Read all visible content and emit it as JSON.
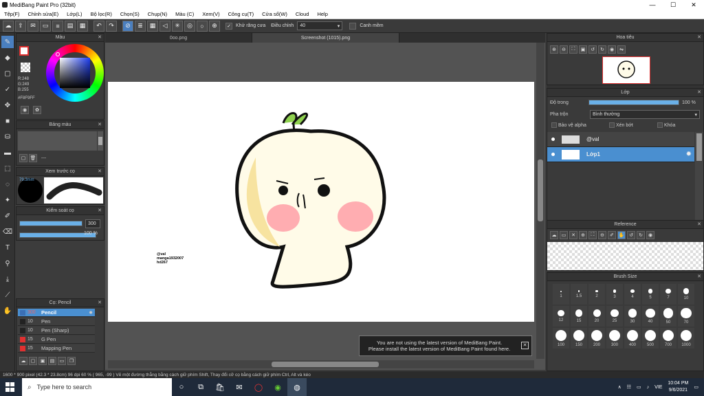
{
  "window": {
    "title": "MediBang Paint Pro (32bit)",
    "min": "—",
    "max": "☐",
    "close": "✕"
  },
  "menu": [
    "Tệp(F)",
    "Chỉnh sửa(E)",
    "Lớp(L)",
    "Bộ lọc(R)",
    "Chọn(S)",
    "Chụp(N)",
    "Màu (C)",
    "Xem(V)",
    "Công cụ(T)",
    "Cửa sổ(W)",
    "Cloud",
    "Help"
  ],
  "toolbar": {
    "antialias": "Khử răng cưa",
    "adjust": "Điều chỉnh",
    "adjust_value": "40",
    "smoothing": "Canh mềm"
  },
  "tabs": [
    "0oo.png",
    "Screenshot (1015).png"
  ],
  "color_panel": {
    "title": "Màu",
    "r": "R:248",
    "g": "G:249",
    "b": "B:255",
    "hex": "#F8F9FF"
  },
  "palette_panel": {
    "title": "Bảng màu",
    "dash": "---"
  },
  "preview_panel": {
    "title": "Xem trước cọ",
    "size": "79.3mm"
  },
  "brush_control": {
    "title": "Kiểm soát cọ",
    "size": "300",
    "opacity": "100 %"
  },
  "brush_list": {
    "title": "Cọ: Pencil",
    "items": [
      {
        "size": "300",
        "name": "Pencil",
        "color": "#3b6fb5"
      },
      {
        "size": "10",
        "name": "Pen",
        "color": "#222"
      },
      {
        "size": "10",
        "name": "Pen (Sharp)",
        "color": "#222"
      },
      {
        "size": "15",
        "name": "G Pen",
        "color": "#e03030"
      },
      {
        "size": "15",
        "name": "Mapping Pen",
        "color": "#e03030"
      }
    ]
  },
  "navigator": {
    "title": "Hoa tiêu"
  },
  "layer_panel": {
    "title": "Lớp",
    "opacity_label": "Độ trong",
    "opacity_value": "100 %",
    "blend_label": "Pha trộn",
    "blend_value": "Bình thường",
    "protect_alpha": "Bảo vệ alpha",
    "clip": "Xén bớt",
    "lock": "Khóa",
    "layers": [
      {
        "name": "@val"
      },
      {
        "name": "Lớp1"
      }
    ]
  },
  "reference_panel": {
    "title": "Reference"
  },
  "brush_size_panel": {
    "title": "Brush Size",
    "sizes": [
      "1",
      "1.5",
      "2",
      "3",
      "4",
      "5",
      "7",
      "10",
      "12",
      "15",
      "20",
      "25",
      "30",
      "40",
      "50",
      "70",
      "100",
      "150",
      "200",
      "300",
      "400",
      "500",
      "700",
      "1000"
    ]
  },
  "canvas_text": {
    "line1": "@val",
    "line2": "manga1932007",
    "line3": "hd267"
  },
  "notification": {
    "line1": "You are not using the latest version of MediBang Paint.",
    "line2": "Please install the latest version of MediBang Paint found here."
  },
  "statusbar": "1600 * 900 pixel  (42.3 * 23.8cm)  96 dpi  60 %  ( 965, -99 )  Vẽ một đường thẳng bằng cách giữ phím Shift, Thay đổi cỡ cọ bằng cách giữ phím Ctrl, Alt và kéo",
  "taskbar": {
    "search": "Type here to search",
    "lang": "VIE",
    "time": "10:04 PM",
    "date": "9/6/2021"
  }
}
